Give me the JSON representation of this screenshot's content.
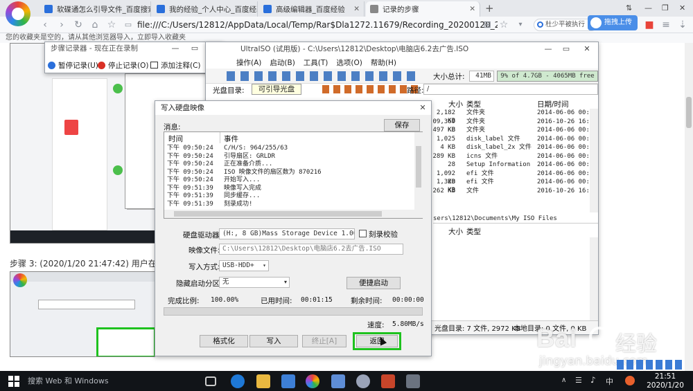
{
  "browser": {
    "tabs": [
      {
        "label": "软碟通怎么引导文件_百度搜索",
        "close": "✕"
      },
      {
        "label": "我的经验_个人中心_百度经验",
        "close": "✕"
      },
      {
        "label": "高级编辑器_百度经验",
        "close": "✕"
      },
      {
        "label": "记录的步骤",
        "close": "✕"
      }
    ],
    "new_tab": "+",
    "window_controls": [
      "⇅",
      "—",
      "❐",
      "✕"
    ],
    "address": "file:///C:/Users/12812/AppData/Local/Temp/Rar$Dla1272.11679/Recording_20200120_2148.m",
    "search_placeholder": "杜少平被执行",
    "ext_label": "拖拽上传",
    "bookmarks_text": "您的收藏夹是空的，请从其他浏览器导入，立即导入收藏夹"
  },
  "steps_recorder": {
    "title": "步骤记录器 - 现在正在录制",
    "pause_label": "暂停记录(U)",
    "stop_label": "停止记录(O)",
    "add_comment_label": "添加注释(C)",
    "help": "?"
  },
  "page": {
    "step_caption": "步骤 3: (2020/1/20 21:47:42) 用户在\"写入硬"
  },
  "ultraiso": {
    "title": "UltraISO (试用版) - C:\\Users\\12812\\Desktop\\电脑店6.2去广告.ISO",
    "menus": [
      "操作(A)",
      "启动(B)",
      "工具(T)",
      "选项(O)",
      "帮助(H)"
    ],
    "total_size_label": "大小总计:",
    "total_size_value": "41MB",
    "capacity_text": "9% of 4.7GB - 4065MB free",
    "disc_dir_label": "光盘目录:",
    "boot_disc_label": "可引导光盘",
    "path_label": "路径:",
    "path_value": "/",
    "columns": [
      "大小",
      "类型",
      "日期/时间"
    ],
    "files": [
      {
        "size": "2,182 KB",
        "type": "文件夹",
        "date": "2014-06-06 00:00"
      },
      {
        "size": "09,369 KB",
        "type": "文件夹",
        "date": "2016-10-26 16:52"
      },
      {
        "size": "497 KB",
        "type": "文件夹",
        "date": "2014-06-06 00:00"
      },
      {
        "size": "1,025",
        "type": "disk_label 文件",
        "date": "2014-06-06 00:00"
      },
      {
        "size": "4 KB",
        "type": "disk_label_2x 文件",
        "date": "2014-06-06 00:00"
      },
      {
        "size": "289 KB",
        "type": "icns 文件",
        "date": "2014-06-06 00:00"
      },
      {
        "size": "28",
        "type": "Setup Information",
        "date": "2014-06-06 00:00"
      },
      {
        "size": "1,092 KB",
        "type": "efi 文件",
        "date": "2014-06-06 00:00"
      },
      {
        "size": "1,320 KB",
        "type": "efi 文件",
        "date": "2014-06-06 00:00"
      },
      {
        "size": "262 KB",
        "type": "文件",
        "date": "2016-10-26 16:51"
      }
    ],
    "local_path": "sers\\12812\\Documents\\My ISO Files",
    "lower_columns": [
      "大小",
      "类型"
    ],
    "status_left": "光盘目录: 7 文件, 2972 KB",
    "status_right": "本地目录: 0 文件, 0 KB"
  },
  "write_dialog": {
    "title": "写入硬盘映像",
    "message_label": "消息:",
    "save_button": "保存",
    "log_headers": [
      "时间",
      "事件"
    ],
    "log": [
      {
        "time": "下午 09:50:24",
        "event": "C/H/S: 964/255/63"
      },
      {
        "time": "下午 09:50:24",
        "event": "引导扇区: GRLDR"
      },
      {
        "time": "下午 09:50:24",
        "event": "正在准备介质..."
      },
      {
        "time": "下午 09:50:24",
        "event": "ISO 映像文件的扇区数为 870216"
      },
      {
        "time": "下午 09:50:24",
        "event": "开始写入..."
      },
      {
        "time": "下午 09:51:39",
        "event": "映像写入完成"
      },
      {
        "time": "下午 09:51:39",
        "event": "同步缓存..."
      },
      {
        "time": "下午 09:51:39",
        "event": "刻录成功!"
      }
    ],
    "drive_label": "硬盘驱动器:",
    "drive_value": "(H:, 8 GB)Mass    Storage Device  1.00",
    "verify_label": "刻录校验",
    "image_label": "映像文件:",
    "image_value": "C:\\Users\\12812\\Desktop\\电脑店6.2去广告.ISO",
    "write_method_label": "写入方式:",
    "write_method_value": "USB-HDD+",
    "hidden_partition_label": "隐藏启动分区:",
    "hidden_partition_value": "无",
    "convenient_boot_button": "便捷启动",
    "completion_label": "完成比例:",
    "completion_value": "100.00%",
    "elapsed_label": "已用时间:",
    "elapsed_value": "00:01:15",
    "remaining_label": "剩余时间:",
    "remaining_value": "00:00:00",
    "progress_fraction": 1.0,
    "speed_label": "速度:",
    "speed_value": "5.80MB/s",
    "format_button": "格式化",
    "write_button": "写入",
    "stop_button": "终止[A]",
    "back_button": "返回"
  },
  "watermark": {
    "brand": "Bai",
    "brand_cn": "经验",
    "site": "jingyan.baidu.com"
  },
  "taskbar": {
    "search_text": "搜索 Web 和 Windows",
    "ime": "中",
    "time": "21:51",
    "date": "2020/1/20"
  },
  "colors": {
    "accent": "#2a6fdb",
    "highlight_green": "#1ec21e",
    "taskbar_bg": "#111418"
  }
}
